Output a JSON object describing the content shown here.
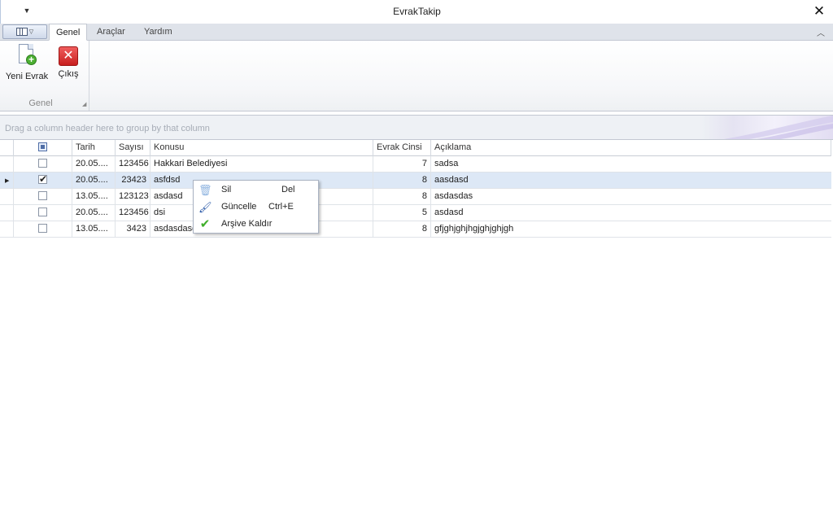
{
  "window": {
    "title": "EvrakTakip"
  },
  "tabs": [
    {
      "label": "Genel",
      "active": true
    },
    {
      "label": "Araçlar",
      "active": false
    },
    {
      "label": "Yardım",
      "active": false
    }
  ],
  "ribbon": {
    "group_caption": "Genel",
    "buttons": [
      {
        "label": "Yeni Evrak",
        "icon": "new-document-icon"
      },
      {
        "label": "Çıkış",
        "icon": "exit-icon"
      }
    ]
  },
  "grid": {
    "group_panel_text": "Drag a column header here to group by that column",
    "columns": [
      "Tarih",
      "Sayısı",
      "Konusu",
      "Evrak Cinsi",
      "Açıklama"
    ],
    "rows": [
      {
        "checked": false,
        "tarih": "20.05....",
        "sayisi": "123456",
        "konusu": "Hakkari Belediyesi",
        "evrak_cinsi": "7",
        "aciklama": "sadsa"
      },
      {
        "checked": true,
        "tarih": "20.05....",
        "sayisi": "23423",
        "konusu": "asfdsd",
        "evrak_cinsi": "8",
        "aciklama": "aasdasd"
      },
      {
        "checked": false,
        "tarih": "13.05....",
        "sayisi": "123123",
        "konusu": "asdasd",
        "evrak_cinsi": "8",
        "aciklama": "asdasdas"
      },
      {
        "checked": false,
        "tarih": "20.05....",
        "sayisi": "123456",
        "konusu": "dsi",
        "evrak_cinsi": "5",
        "aciklama": "asdasd"
      },
      {
        "checked": false,
        "tarih": "13.05....",
        "sayisi": "3423",
        "konusu": "asdasdasd",
        "evrak_cinsi": "8",
        "aciklama": "gfjghjghjhgjghjghjgh"
      }
    ],
    "selected_row_index": 1
  },
  "context_menu": {
    "items": [
      {
        "label": "Sil",
        "shortcut": "Del",
        "icon": "trash-icon"
      },
      {
        "label": "Güncelle",
        "shortcut": "Ctrl+E",
        "icon": "brush-icon"
      },
      {
        "label": "Arşive Kaldır",
        "shortcut": "",
        "icon": "checkmark-icon"
      }
    ]
  },
  "colors": {
    "accent": "#4f6da6",
    "selected_row": "#dde8f6",
    "exit_red": "#d42a2a",
    "add_green": "#4caf32"
  }
}
